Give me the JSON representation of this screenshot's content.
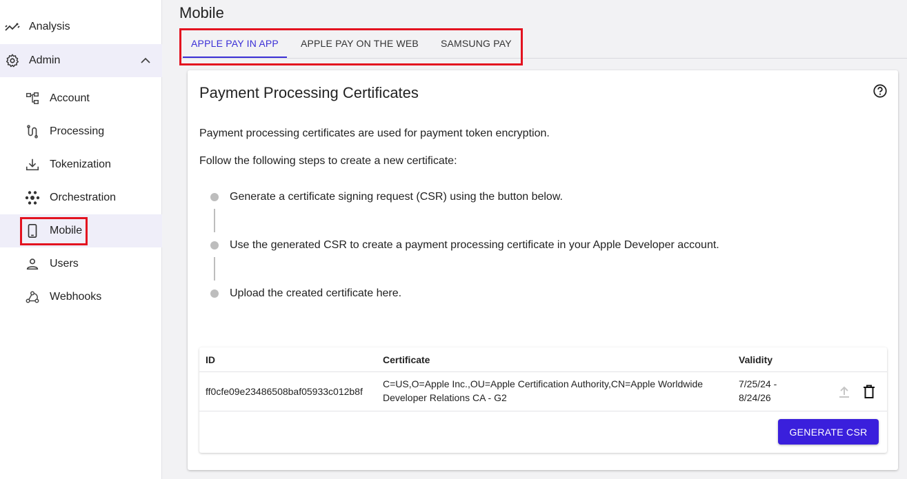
{
  "sidebar": {
    "items": [
      {
        "label": "Analysis",
        "icon": "analysis-icon"
      },
      {
        "label": "Admin",
        "icon": "gear-icon"
      },
      {
        "label": "Account",
        "icon": "account-tree-icon"
      },
      {
        "label": "Processing",
        "icon": "processing-icon"
      },
      {
        "label": "Tokenization",
        "icon": "download-tray-icon"
      },
      {
        "label": "Orchestration",
        "icon": "orchestration-hub-icon"
      },
      {
        "label": "Mobile",
        "icon": "phone-icon"
      },
      {
        "label": "Users",
        "icon": "user-icon"
      },
      {
        "label": "Webhooks",
        "icon": "webhooks-icon"
      }
    ],
    "active_item": "Mobile"
  },
  "main": {
    "title": "Mobile",
    "tabs": [
      {
        "label": "APPLE PAY IN APP",
        "active": true
      },
      {
        "label": "APPLE PAY ON THE WEB",
        "active": false
      },
      {
        "label": "SAMSUNG PAY",
        "active": false
      }
    ]
  },
  "card": {
    "title": "Payment Processing Certificates",
    "intro": "Payment processing certificates are used for payment token encryption.",
    "steps_intro": "Follow the following steps to create a new certificate:",
    "steps": [
      "Generate a certificate signing request (CSR) using the button below.",
      "Use the generated CSR to create a payment processing certificate in your Apple Developer account.",
      "Upload the created certificate here."
    ]
  },
  "table": {
    "columns": [
      "ID",
      "Certificate",
      "Validity"
    ],
    "rows": [
      {
        "id": "ff0cfe09e23486508baf05933c012b8f",
        "certificate_line1": "C=US,O=Apple Inc.,OU=Apple Certification Authority,CN=Apple Worldwide",
        "certificate_line2": "Developer Relations CA - G2",
        "validity_line1": "7/25/24 -",
        "validity_line2": "8/24/26"
      }
    ],
    "generate_button": "GENERATE CSR"
  },
  "colors": {
    "accent": "#3a2fd6",
    "button": "#3a1fdc",
    "highlight": "#e3121f",
    "active_bg": "#efeef9"
  }
}
